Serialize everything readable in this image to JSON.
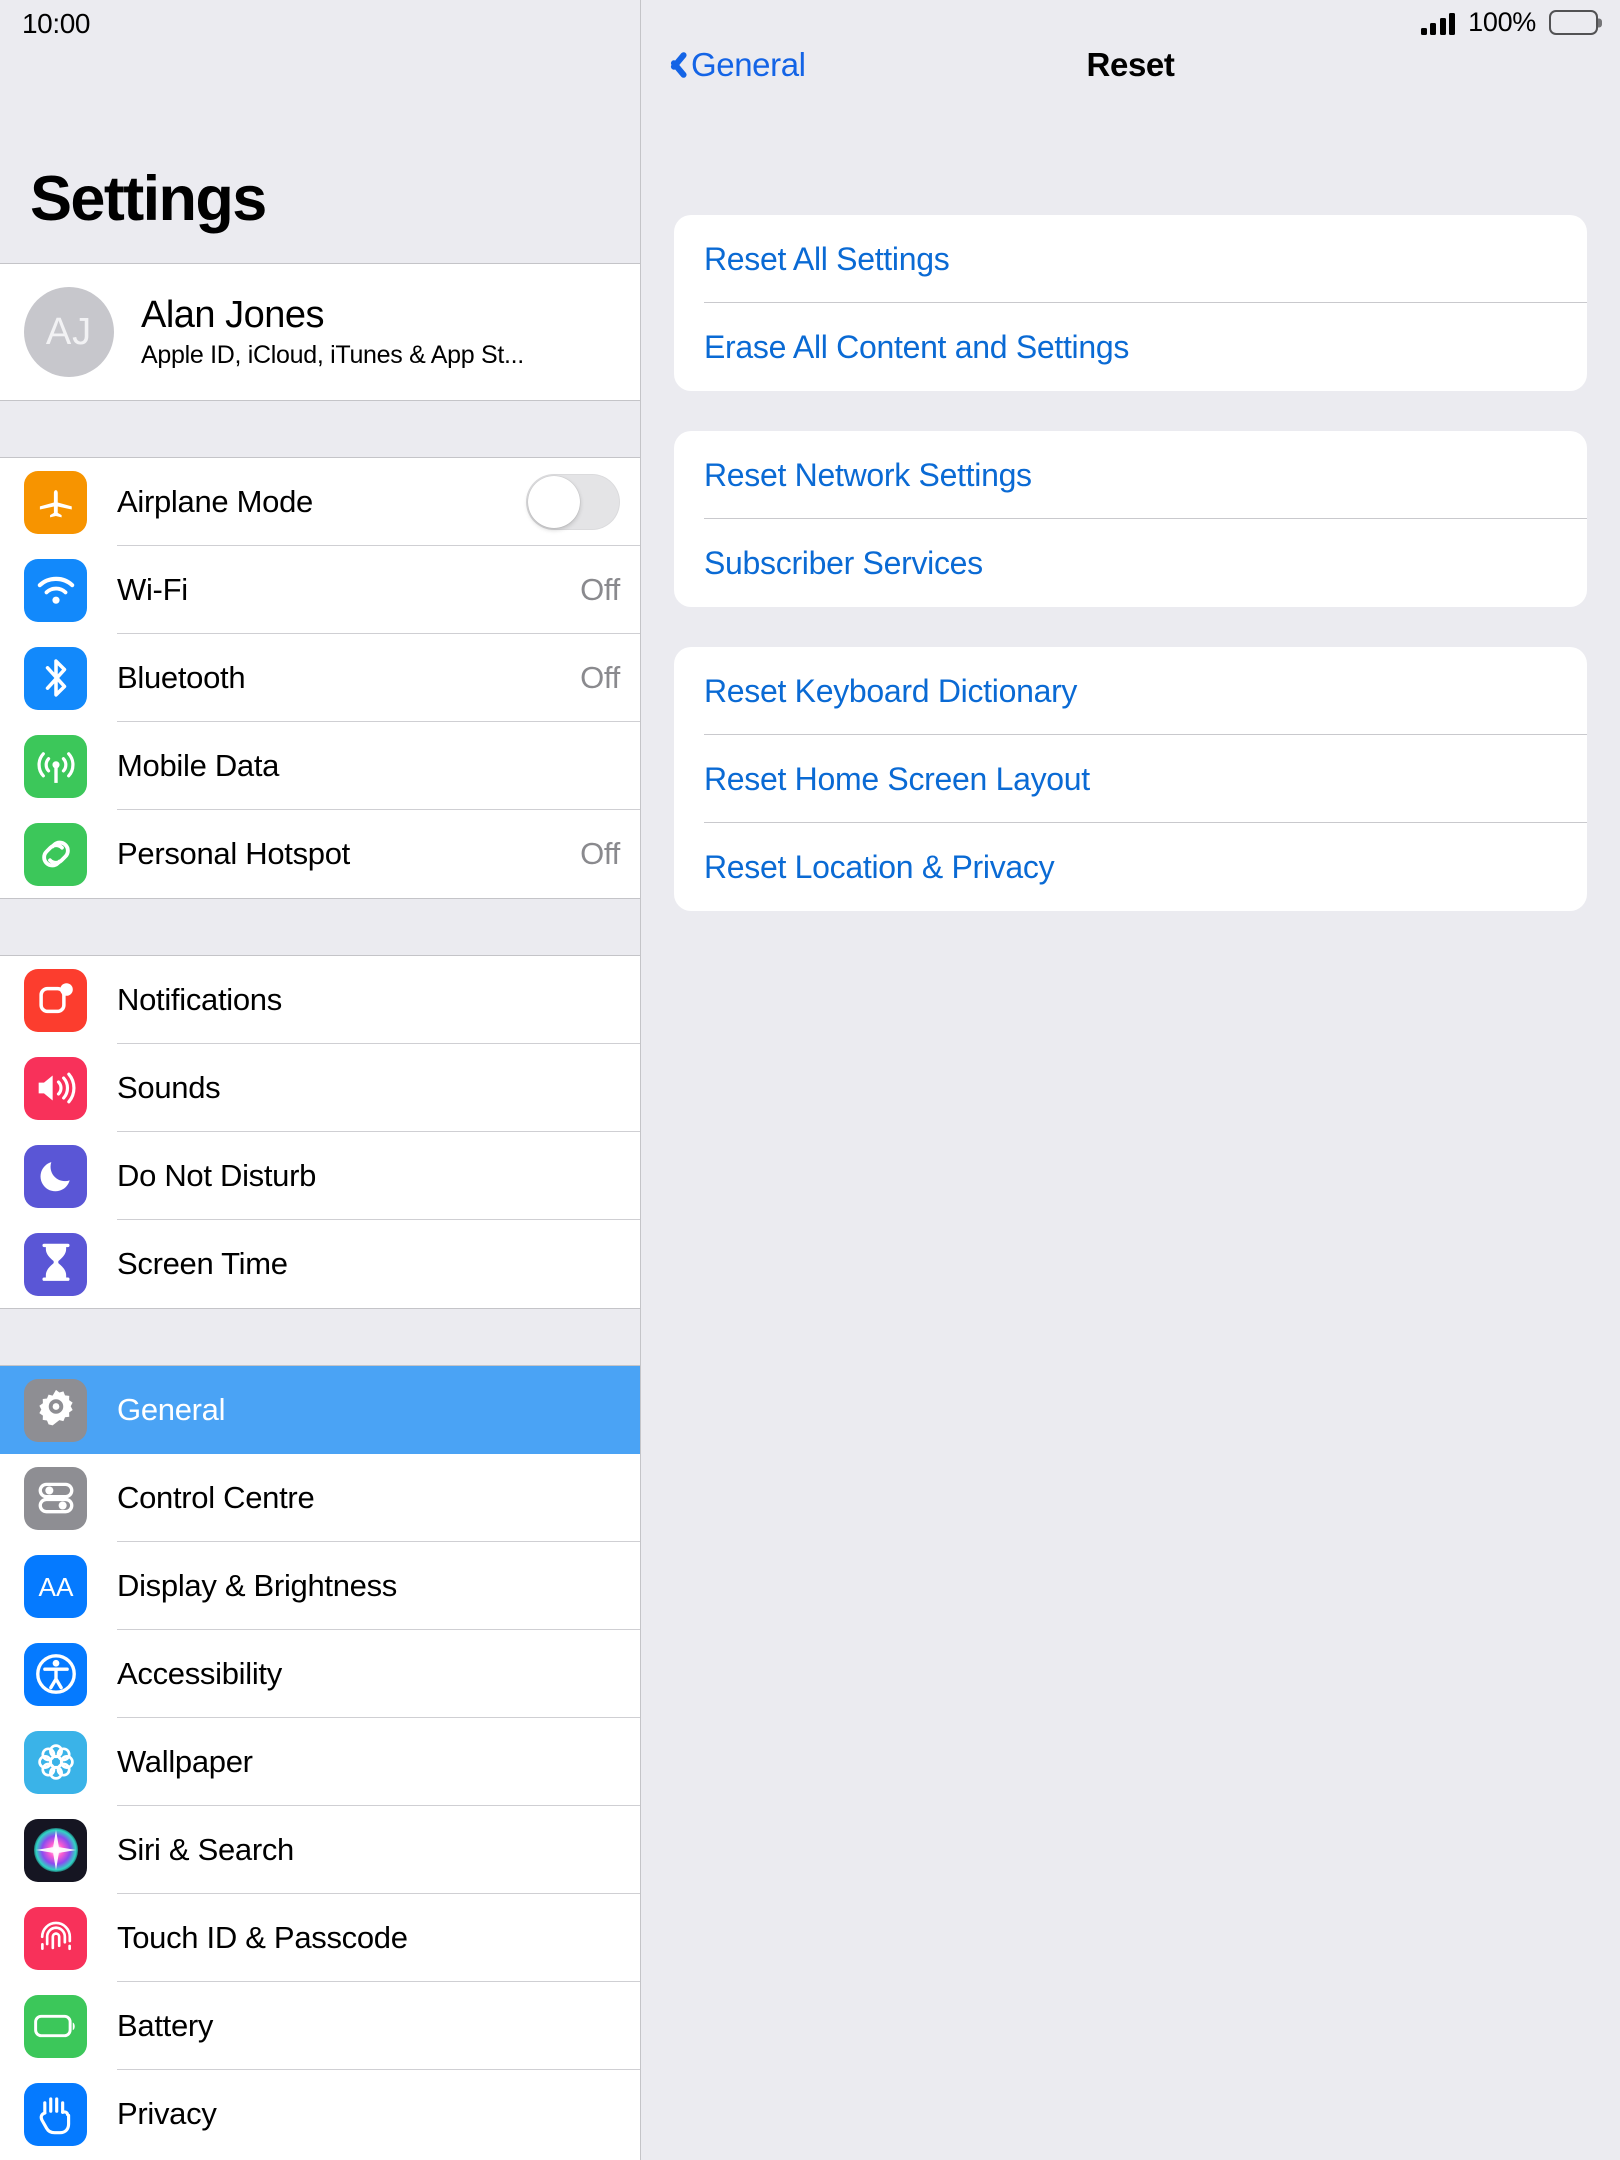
{
  "statusbar": {
    "time": "10:00",
    "signal_icon": "cellular-signal-icon",
    "battery_percent": "100%",
    "battery_icon": "battery-full-icon"
  },
  "sidebar": {
    "title": "Settings",
    "profile": {
      "initials": "AJ",
      "name": "Alan Jones",
      "subtitle": "Apple ID, iCloud, iTunes & App St..."
    },
    "groups": [
      {
        "items": [
          {
            "label": "Airplane Mode",
            "icon": "airplane-icon",
            "control": "toggle",
            "toggle_on": false
          },
          {
            "label": "Wi-Fi",
            "icon": "wifi-icon",
            "value": "Off"
          },
          {
            "label": "Bluetooth",
            "icon": "bluetooth-icon",
            "value": "Off"
          },
          {
            "label": "Mobile Data",
            "icon": "mobile-data-icon",
            "value": ""
          },
          {
            "label": "Personal Hotspot",
            "icon": "personal-hotspot-icon",
            "value": "Off"
          }
        ]
      },
      {
        "items": [
          {
            "label": "Notifications",
            "icon": "notifications-icon",
            "value": ""
          },
          {
            "label": "Sounds",
            "icon": "sounds-icon",
            "value": ""
          },
          {
            "label": "Do Not Disturb",
            "icon": "do-not-disturb-icon",
            "value": ""
          },
          {
            "label": "Screen Time",
            "icon": "screen-time-icon",
            "value": ""
          }
        ]
      },
      {
        "items": [
          {
            "label": "General",
            "icon": "general-gear-icon",
            "value": "",
            "selected": true
          },
          {
            "label": "Control Centre",
            "icon": "control-centre-icon",
            "value": ""
          },
          {
            "label": "Display & Brightness",
            "icon": "display-brightness-icon",
            "value": ""
          },
          {
            "label": "Accessibility",
            "icon": "accessibility-icon",
            "value": ""
          },
          {
            "label": "Wallpaper",
            "icon": "wallpaper-icon",
            "value": ""
          },
          {
            "label": "Siri & Search",
            "icon": "siri-search-icon",
            "value": ""
          },
          {
            "label": "Touch ID & Passcode",
            "icon": "touch-id-icon",
            "value": ""
          },
          {
            "label": "Battery",
            "icon": "battery-icon",
            "value": ""
          },
          {
            "label": "Privacy",
            "icon": "privacy-hand-icon",
            "value": ""
          }
        ]
      }
    ]
  },
  "content": {
    "back_label": "General",
    "title": "Reset",
    "groups": [
      {
        "items": [
          {
            "label": "Reset All Settings"
          },
          {
            "label": "Erase All Content and Settings"
          }
        ]
      },
      {
        "items": [
          {
            "label": "Reset Network Settings"
          },
          {
            "label": "Subscriber Services"
          }
        ]
      },
      {
        "items": [
          {
            "label": "Reset Keyboard Dictionary"
          },
          {
            "label": "Reset Home Screen Layout"
          },
          {
            "label": "Reset Location & Privacy"
          }
        ]
      }
    ]
  },
  "colors": {
    "accent_blue": "#1464e6",
    "link_blue": "#0a6ad4",
    "selected_row": "#4aa3f5",
    "panel_bg": "#ebebf0"
  }
}
